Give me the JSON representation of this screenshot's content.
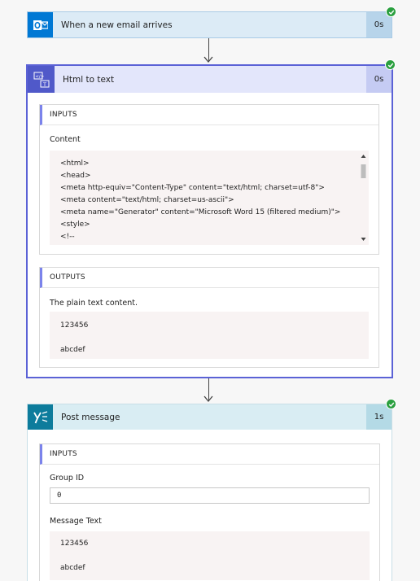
{
  "steps": {
    "trigger": {
      "title": "When a new email arrives",
      "duration": "0s",
      "icon": "outlook-icon",
      "accent": "#0078d4"
    },
    "html_to_text": {
      "title": "Html to text",
      "duration": "0s",
      "icon": "html-to-text-icon",
      "accent": "#5059c9",
      "inputs_label": "INPUTS",
      "content_label": "Content",
      "content_lines": [
        "<html>",
        "<head>",
        "<meta http-equiv=\"Content-Type\" content=\"text/html; charset=utf-8\">",
        "<meta content=\"text/html; charset=us-ascii\">",
        "<meta name=\"Generator\" content=\"Microsoft Word 15 (filtered medium)\">",
        "<style>",
        "<!--"
      ],
      "outputs_label": "OUTPUTS",
      "plain_text_label": "The plain text content.",
      "output_lines": [
        "123456",
        "abcdef"
      ]
    },
    "post_message": {
      "title": "Post message",
      "duration": "1s",
      "icon": "yammer-icon",
      "accent": "#0d7c9c",
      "inputs_label": "INPUTS",
      "group_id_label": "Group ID",
      "group_id_value": "0",
      "message_text_label": "Message Text",
      "message_lines": [
        "123456",
        "abcdef"
      ]
    }
  },
  "colors": {
    "success": "#2a9f3f",
    "selected_border": "#5b62d6"
  }
}
